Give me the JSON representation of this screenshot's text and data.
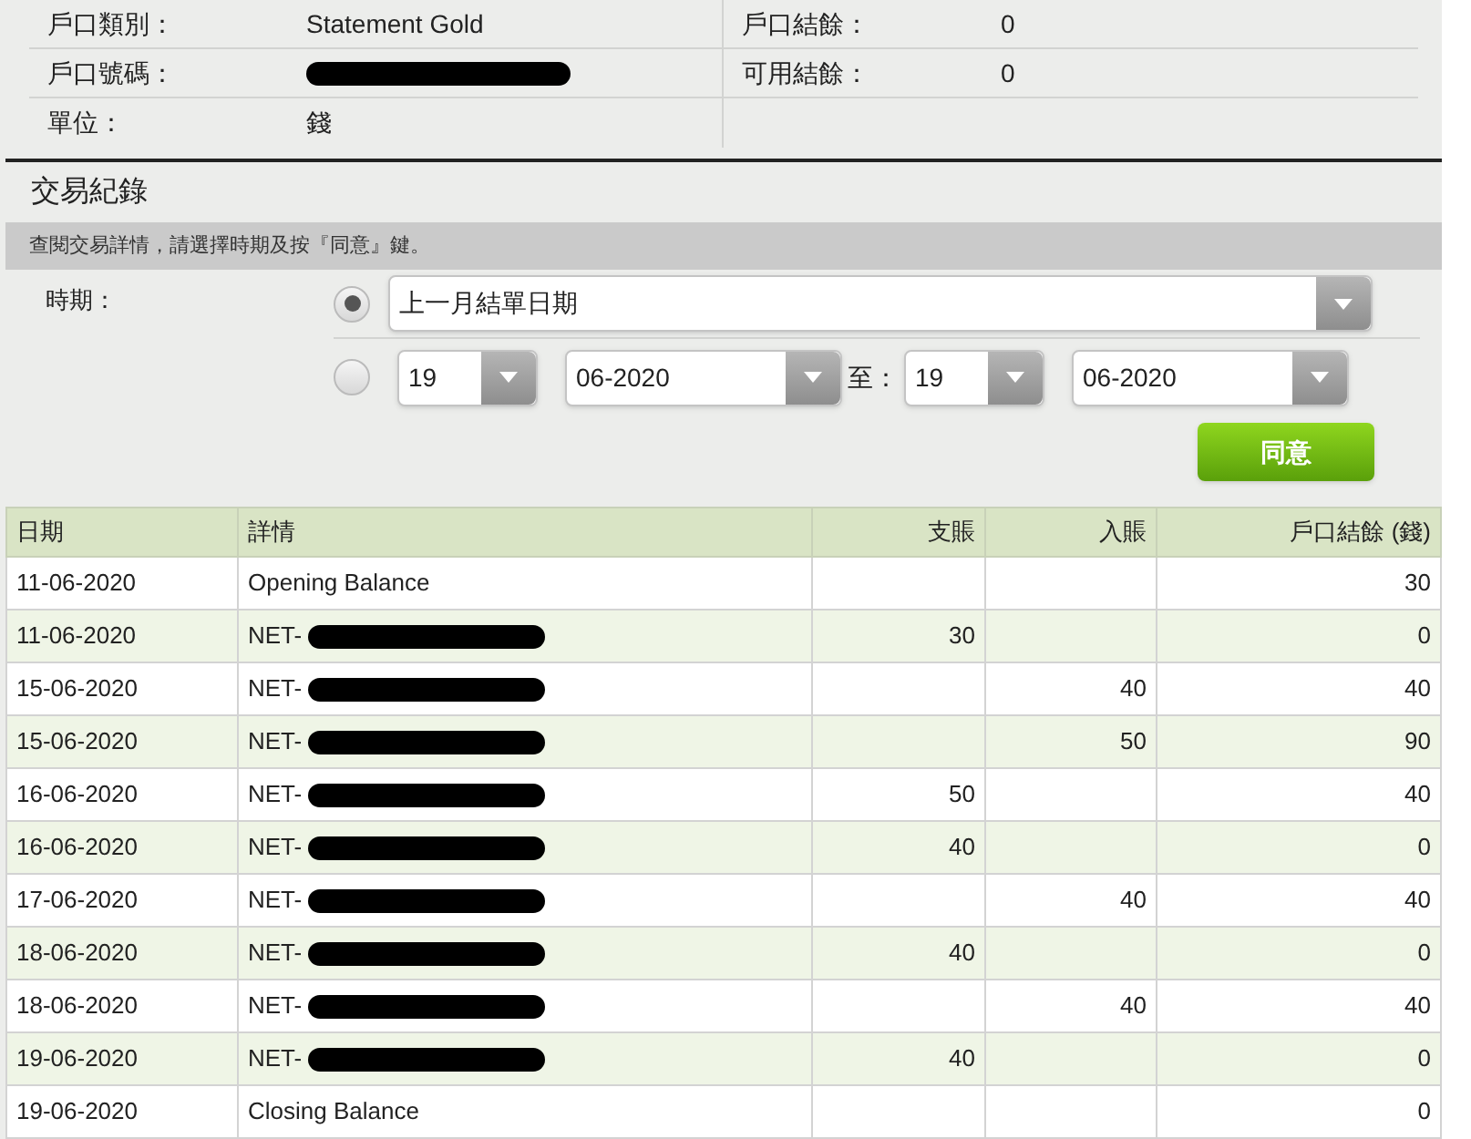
{
  "account_info": {
    "left": [
      {
        "label": "戶口類別：",
        "value": "Statement Gold",
        "redacted": false
      },
      {
        "label": "戶口號碼：",
        "redacted": true
      },
      {
        "label": "單位：",
        "value": "錢",
        "redacted": false
      }
    ],
    "right": [
      {
        "label": "戶口結餘：",
        "value": "0"
      },
      {
        "label": "可用結餘：",
        "value": "0"
      }
    ]
  },
  "section_title": "交易紀錄",
  "instruction": "查閱交易詳情，請選擇時期及按『同意』鍵。",
  "period": {
    "label": "時期：",
    "options": [
      {
        "kind": "preset",
        "selected": true,
        "value": "上一月結單日期"
      },
      {
        "kind": "range",
        "selected": false,
        "from_day": "19",
        "from_month": "06-2020",
        "to_label": "至：",
        "to_day": "19",
        "to_month": "06-2020"
      }
    ]
  },
  "submit_button": "同意",
  "table": {
    "columns": [
      "日期",
      "詳情",
      "支賬",
      "入賬",
      "戶口結餘 (錢)"
    ],
    "rows": [
      {
        "date": "11-06-2020",
        "detail": "Opening Balance",
        "redacted": false,
        "debit": "",
        "credit": "",
        "balance": "30"
      },
      {
        "date": "11-06-2020",
        "detail": "NET-",
        "redacted": true,
        "debit": "30",
        "credit": "",
        "balance": "0"
      },
      {
        "date": "15-06-2020",
        "detail": "NET-",
        "redacted": true,
        "debit": "",
        "credit": "40",
        "balance": "40"
      },
      {
        "date": "15-06-2020",
        "detail": "NET-",
        "redacted": true,
        "debit": "",
        "credit": "50",
        "balance": "90"
      },
      {
        "date": "16-06-2020",
        "detail": "NET-",
        "redacted": true,
        "debit": "50",
        "credit": "",
        "balance": "40"
      },
      {
        "date": "16-06-2020",
        "detail": "NET-",
        "redacted": true,
        "debit": "40",
        "credit": "",
        "balance": "0"
      },
      {
        "date": "17-06-2020",
        "detail": "NET-",
        "redacted": true,
        "debit": "",
        "credit": "40",
        "balance": "40"
      },
      {
        "date": "18-06-2020",
        "detail": "NET-",
        "redacted": true,
        "debit": "40",
        "credit": "",
        "balance": "0"
      },
      {
        "date": "18-06-2020",
        "detail": "NET-",
        "redacted": true,
        "debit": "",
        "credit": "40",
        "balance": "40"
      },
      {
        "date": "19-06-2020",
        "detail": "NET-",
        "redacted": true,
        "debit": "40",
        "credit": "",
        "balance": "0"
      },
      {
        "date": "19-06-2020",
        "detail": "Closing Balance",
        "redacted": false,
        "debit": "",
        "credit": "",
        "balance": "0"
      }
    ]
  }
}
